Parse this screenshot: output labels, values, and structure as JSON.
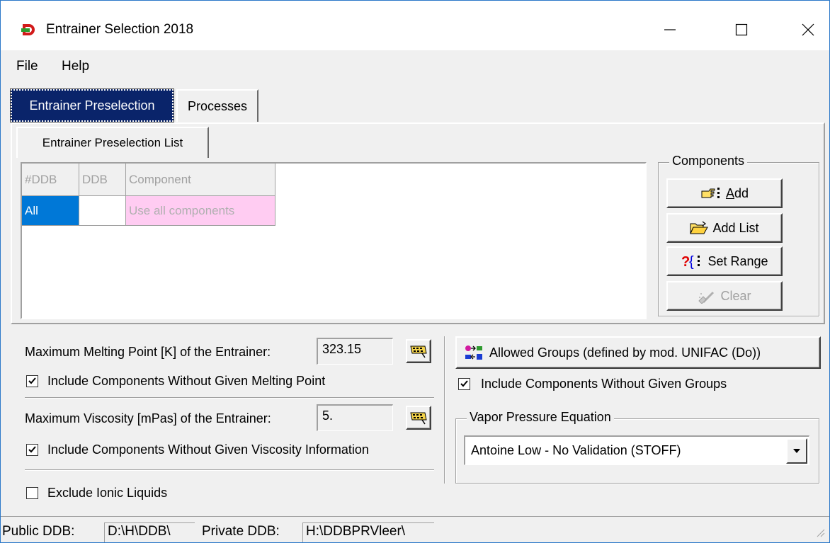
{
  "window": {
    "title": "Entrainer Selection 2018"
  },
  "menu": [
    "File",
    "Help"
  ],
  "tabs": [
    {
      "label": "Entrainer Preselection",
      "active": true
    },
    {
      "label": "Processes",
      "active": false
    }
  ],
  "subtab": {
    "label": "Entrainer Preselection List"
  },
  "grid": {
    "columns": [
      "#DDB",
      "DDB",
      "Component"
    ],
    "rows": [
      {
        "ddb_no": "All",
        "ddb": "",
        "component": "Use all components"
      }
    ]
  },
  "components_group": {
    "title": "Components",
    "add_prefix": "",
    "add_accel": "A",
    "add_rest": "dd",
    "add_list": "Add List",
    "set_range": "Set Range",
    "clear": "Clear"
  },
  "melting": {
    "label": "Maximum Melting Point [K] of the Entrainer:",
    "value": "323.15",
    "include_label": "Include Components Without Given Melting Point",
    "include_checked": true
  },
  "viscosity": {
    "label": "Maximum Viscosity [mPas] of the Entrainer:",
    "value": "5.",
    "include_label": "Include Components Without Given Viscosity Information",
    "include_checked": true
  },
  "ionic": {
    "label": "Exclude Ionic Liquids",
    "checked": false
  },
  "groups": {
    "button_label": "Allowed Groups (defined by mod. UNIFAC (Do))",
    "include_label": "Include Components Without Given Groups",
    "include_checked": true
  },
  "vapor": {
    "title": "Vapor Pressure Equation",
    "selected": "Antoine Low - No Validation (STOFF)"
  },
  "statusbar": {
    "public_label": "Public DDB:",
    "public_value": "D:\\H\\DDB\\",
    "private_label": "Private DDB:",
    "private_value": "H:\\DDBPRVleer\\"
  },
  "colors": {
    "selection": "#0078d7",
    "component_highlight": "#ffccf2",
    "active_tab": "#0a246a"
  }
}
